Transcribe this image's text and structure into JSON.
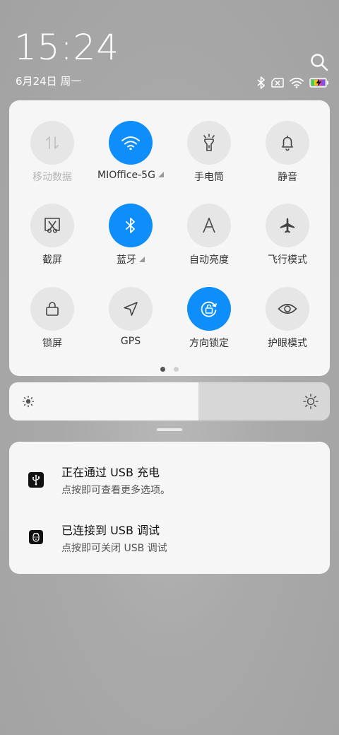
{
  "status": {
    "time": "15:24",
    "date": "6月24日 周一",
    "icons": [
      "bluetooth-icon",
      "sim-disabled-icon",
      "wifi-icon",
      "battery-charging-icon"
    ]
  },
  "quick_settings": {
    "tiles": [
      {
        "label": "移动数据",
        "icon": "mobile-data-icon",
        "active": false,
        "disabled": true
      },
      {
        "label": "MIOffice-5G",
        "icon": "wifi-icon",
        "active": true,
        "has_more": true
      },
      {
        "label": "手电筒",
        "icon": "flashlight-icon",
        "active": false
      },
      {
        "label": "静音",
        "icon": "bell-icon",
        "active": false
      },
      {
        "label": "截屏",
        "icon": "screenshot-icon",
        "active": false
      },
      {
        "label": "蓝牙",
        "icon": "bluetooth-icon",
        "active": true,
        "has_more": true
      },
      {
        "label": "自动亮度",
        "icon": "auto-brightness-icon",
        "active": false
      },
      {
        "label": "飞行模式",
        "icon": "airplane-icon",
        "active": false
      },
      {
        "label": "锁屏",
        "icon": "lock-icon",
        "active": false
      },
      {
        "label": "GPS",
        "icon": "location-arrow-icon",
        "active": false
      },
      {
        "label": "方向锁定",
        "icon": "rotation-lock-icon",
        "active": true
      },
      {
        "label": "护眼模式",
        "icon": "eye-icon",
        "active": false
      }
    ],
    "page_count": 2,
    "current_page": 1
  },
  "brightness": {
    "level": 0.59
  },
  "notifications": [
    {
      "title": "正在通过 USB 充电",
      "subtitle": "点按即可查看更多选项。",
      "icon": "usb-icon"
    },
    {
      "title": "已连接到 USB 调试",
      "subtitle": "点按即可关闭 USB 调试",
      "icon": "debug-bug-icon"
    }
  ],
  "colors": {
    "accent": "#0d8efa",
    "panel": "#f6f6f6",
    "tile_off": "#e6e6e6"
  }
}
